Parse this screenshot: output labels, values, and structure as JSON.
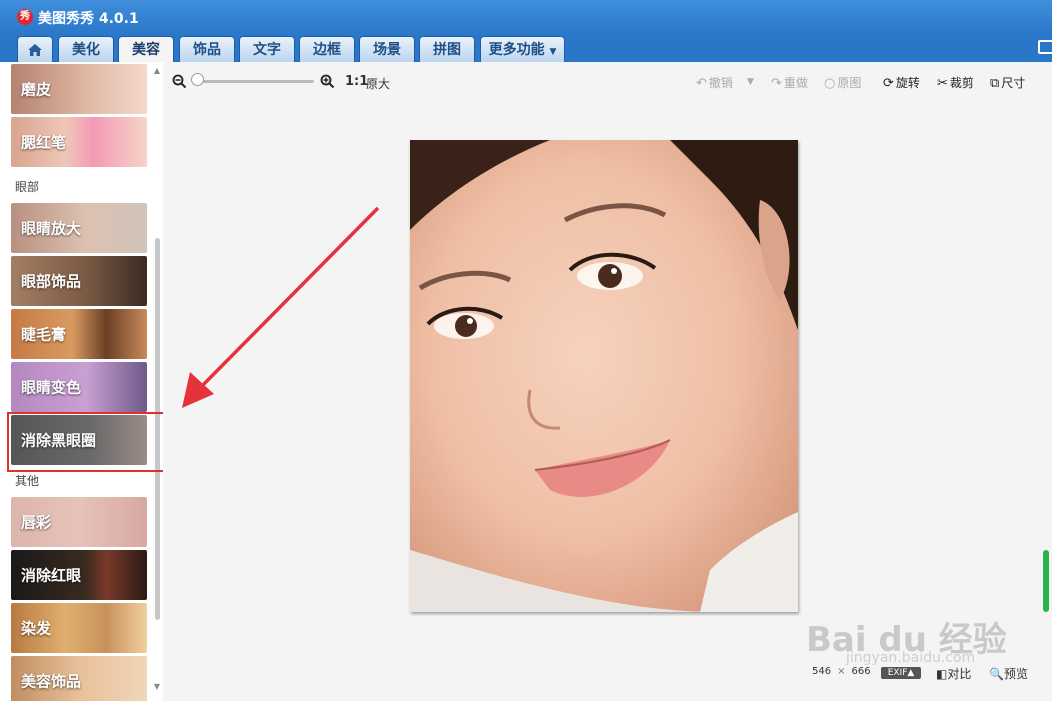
{
  "app": {
    "title": "美图秀秀 4.0.1",
    "logo_char": "秀"
  },
  "tabs": [
    {
      "label": "美化"
    },
    {
      "label": "美容"
    },
    {
      "label": "饰品"
    },
    {
      "label": "文字"
    },
    {
      "label": "边框"
    },
    {
      "label": "场景"
    },
    {
      "label": "拼图"
    }
  ],
  "more_tab": {
    "label": "更多功能"
  },
  "sidebar": {
    "items_face": [
      {
        "label": "磨皮"
      },
      {
        "label": "腮红笔"
      }
    ],
    "section_eyes": "眼部",
    "items_eyes": [
      {
        "label": "眼睛放大"
      },
      {
        "label": "眼部饰品"
      },
      {
        "label": "睫毛膏"
      },
      {
        "label": "眼睛变色"
      },
      {
        "label": "消除黑眼圈"
      }
    ],
    "section_other": "其他",
    "items_other": [
      {
        "label": "唇彩"
      },
      {
        "label": "消除红眼"
      },
      {
        "label": "染发"
      },
      {
        "label": "美容饰品"
      }
    ]
  },
  "toolbar": {
    "ratio_btn": "1:1",
    "ratio_text": "原大",
    "undo": "撤销",
    "redo": "重做",
    "original": "原图",
    "rotate": "旋转",
    "crop": "裁剪",
    "resize": "尺寸"
  },
  "status": {
    "width": "546",
    "sep": "×",
    "height": "666",
    "exif": "EXIF▲",
    "compare": "对比",
    "preview": "预览"
  },
  "watermark": {
    "main": "Bai du 经验",
    "sub": "jingyan.baidu.com"
  },
  "colors": {
    "titlebar": "#2a76c8",
    "highlight": "#e03131",
    "scroll_accent": "#29b34a"
  }
}
